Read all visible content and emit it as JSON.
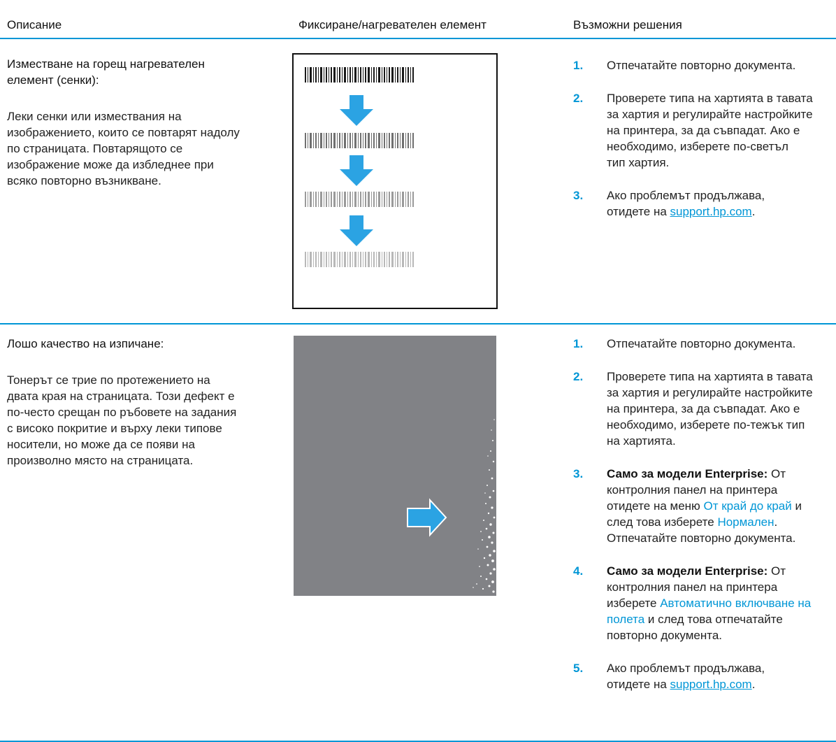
{
  "header": {
    "col_description": "Описание",
    "col_figure": "Фиксиране/нагревателен елемент",
    "col_solutions": "Възможни решения"
  },
  "row1": {
    "title_line1": "Изместване на горещ нагревателен",
    "title_line2": "елемент (сенки):",
    "desc_lines": [
      "Леки сенки или измествания на",
      "изображението, които се повтарят надолу",
      "по страницата. Повтарящото се",
      "изображение може да избледнее при",
      "всяко повторно възникване."
    ],
    "figure_icons": [
      "barcode-icon",
      "arrow-down-icon"
    ],
    "steps": [
      {
        "num": "1.",
        "text": "Отпечатайте повторно документа."
      },
      {
        "num": "2.",
        "lines": [
          "Проверете типа на хартията в тавата",
          "за хартия и регулирайте настройките",
          "на принтера, за да съвпадат. Ако е",
          "необходимо, изберете по-светъл",
          "тип хартия."
        ]
      },
      {
        "num": "3.",
        "line1": "Ако проблемът продължава,",
        "prefix": "отидете на ",
        "link": "support.hp.com",
        "suffix": "."
      }
    ]
  },
  "row2": {
    "title_line1": "Лошо качество на изпичане:",
    "desc_lines": [
      "Тонерът се трие по протежението на",
      "двата края на страницата. Този дефект е",
      "по-често срещан по ръбовете на задания",
      "с високо покритие и върху леки типове",
      "носители, но може да се появи на",
      "произволно място на страницата."
    ],
    "figure_icons": [
      "arrow-right-icon"
    ],
    "steps": [
      {
        "num": "1.",
        "text": "Отпечатайте повторно документа."
      },
      {
        "num": "2.",
        "lines": [
          "Проверете типа на хартията в тавата",
          "за хартия и регулирайте настройките",
          "на принтера, за да съвпадат. Ако е",
          "необходимо, изберете по-тежък тип",
          "на хартията."
        ]
      },
      {
        "num": "3.",
        "bold": "Само за модели Enterprise:",
        "t1": " От",
        "t2": "контролния панел на принтера",
        "t3": "отидете на меню ",
        "menu": "От край до край",
        "t4": " и",
        "t5": "след това изберете ",
        "option": "Нормален",
        "t6": ".",
        "t7": "Отпечатайте повторно документа."
      },
      {
        "num": "4.",
        "bold": "Само за модели Enterprise:",
        "t1": " От",
        "t2": "контролния панел на принтера",
        "t3": "изберете ",
        "option_a": "Автоматично включване на",
        "option_b": "полета",
        "t4": " и след това отпечатайте",
        "t5": "повторно документа."
      },
      {
        "num": "5.",
        "line1": "Ако проблемът продължава,",
        "prefix": "отидете на ",
        "link": "support.hp.com",
        "suffix": "."
      }
    ]
  },
  "colors": {
    "accent": "#0096d6",
    "gray_page": "#818286",
    "text": "#1a1a1a"
  }
}
